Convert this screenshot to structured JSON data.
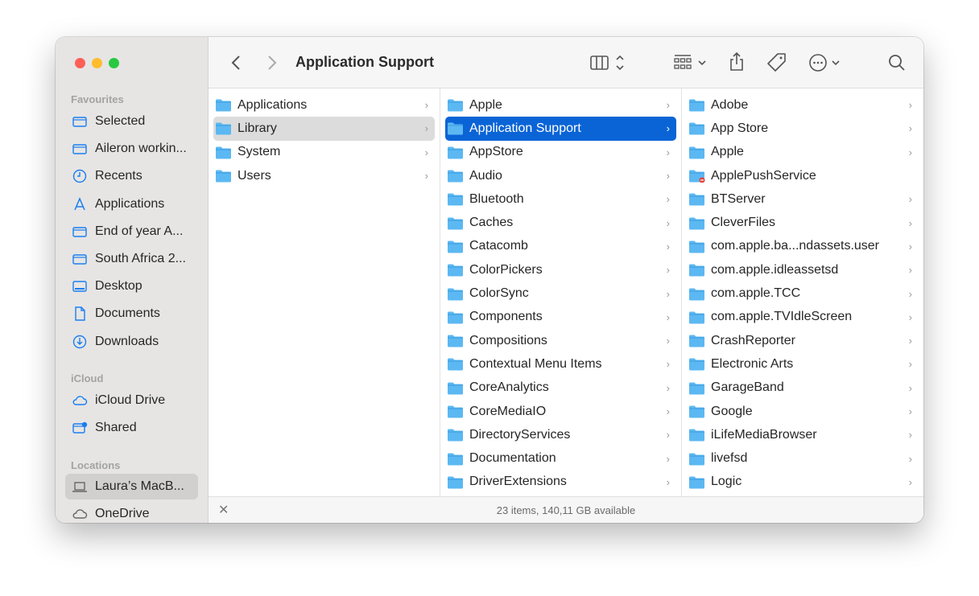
{
  "window": {
    "title": "Application Support"
  },
  "sidebar": {
    "favourites_label": "Favourites",
    "favourites": [
      {
        "label": "Selected",
        "icon": "folder-icon"
      },
      {
        "label": "Aileron workin...",
        "icon": "folder-icon"
      },
      {
        "label": "Recents",
        "icon": "clock-icon"
      },
      {
        "label": "Applications",
        "icon": "applications-icon"
      },
      {
        "label": "End of year A...",
        "icon": "folder-icon"
      },
      {
        "label": "South Africa 2...",
        "icon": "folder-icon"
      },
      {
        "label": "Desktop",
        "icon": "desktop-icon"
      },
      {
        "label": "Documents",
        "icon": "document-icon"
      },
      {
        "label": "Downloads",
        "icon": "download-icon"
      }
    ],
    "icloud_label": "iCloud",
    "icloud": [
      {
        "label": "iCloud Drive",
        "icon": "cloud-icon"
      },
      {
        "label": "Shared",
        "icon": "shared-folder-icon"
      }
    ],
    "locations_label": "Locations",
    "locations": [
      {
        "label": "Laura’s MacB...",
        "icon": "laptop-icon"
      },
      {
        "label": "OneDrive",
        "icon": "cloud-icon"
      }
    ]
  },
  "columns": [
    {
      "items": [
        "Applications",
        "Library",
        "System",
        "Users"
      ],
      "selected": "Library"
    },
    {
      "items": [
        "Apple",
        "Application Support",
        "AppStore",
        "Audio",
        "Bluetooth",
        "Caches",
        "Catacomb",
        "ColorPickers",
        "ColorSync",
        "Components",
        "Compositions",
        "Contextual Menu Items",
        "CoreAnalytics",
        "CoreMediaIO",
        "DirectoryServices",
        "Documentation",
        "DriverExtensions"
      ],
      "selected": "Application Support"
    },
    {
      "items": [
        "Adobe",
        "App Store",
        "Apple",
        "ApplePushService",
        "BTServer",
        "CleverFiles",
        "com.apple.ba...ndassets.user",
        "com.apple.idleassetsd",
        "com.apple.TCC",
        "com.apple.TVIdleScreen",
        "CrashReporter",
        "Electronic Arts",
        "GarageBand",
        "Google",
        "iLifeMediaBrowser",
        "livefsd",
        "Logic"
      ],
      "restricted": "ApplePushService"
    }
  ],
  "status": {
    "text": "23 items, 140,11 GB available"
  },
  "colors": {
    "accent": "#0a64d6",
    "folder": "#5cb8f2"
  }
}
